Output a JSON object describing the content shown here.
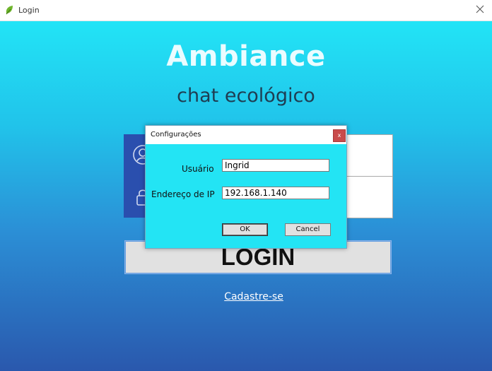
{
  "window": {
    "title": "Login",
    "close_symbol": "✕"
  },
  "app": {
    "title": "Ambiance",
    "subtitle": "chat ecológico"
  },
  "login_form": {
    "username_value": "",
    "password_value": "",
    "login_label": "LOGIN",
    "signup_label": "Cadastre-se"
  },
  "dialog": {
    "title": "Configurações",
    "close_symbol": "x",
    "user_label": "Usuário",
    "user_value": "Ingrid",
    "ip_label": "Endereço de IP",
    "ip_value": "192.168.1.140",
    "ok_label": "OK",
    "cancel_label": "Cancel"
  },
  "colors": {
    "dialog_bg": "#23e4f4",
    "icon_panel": "#2a4fae",
    "close_red": "#c94b4b"
  },
  "icons": [
    "leaf-icon",
    "user-icon",
    "lock-icon",
    "close-icon"
  ]
}
